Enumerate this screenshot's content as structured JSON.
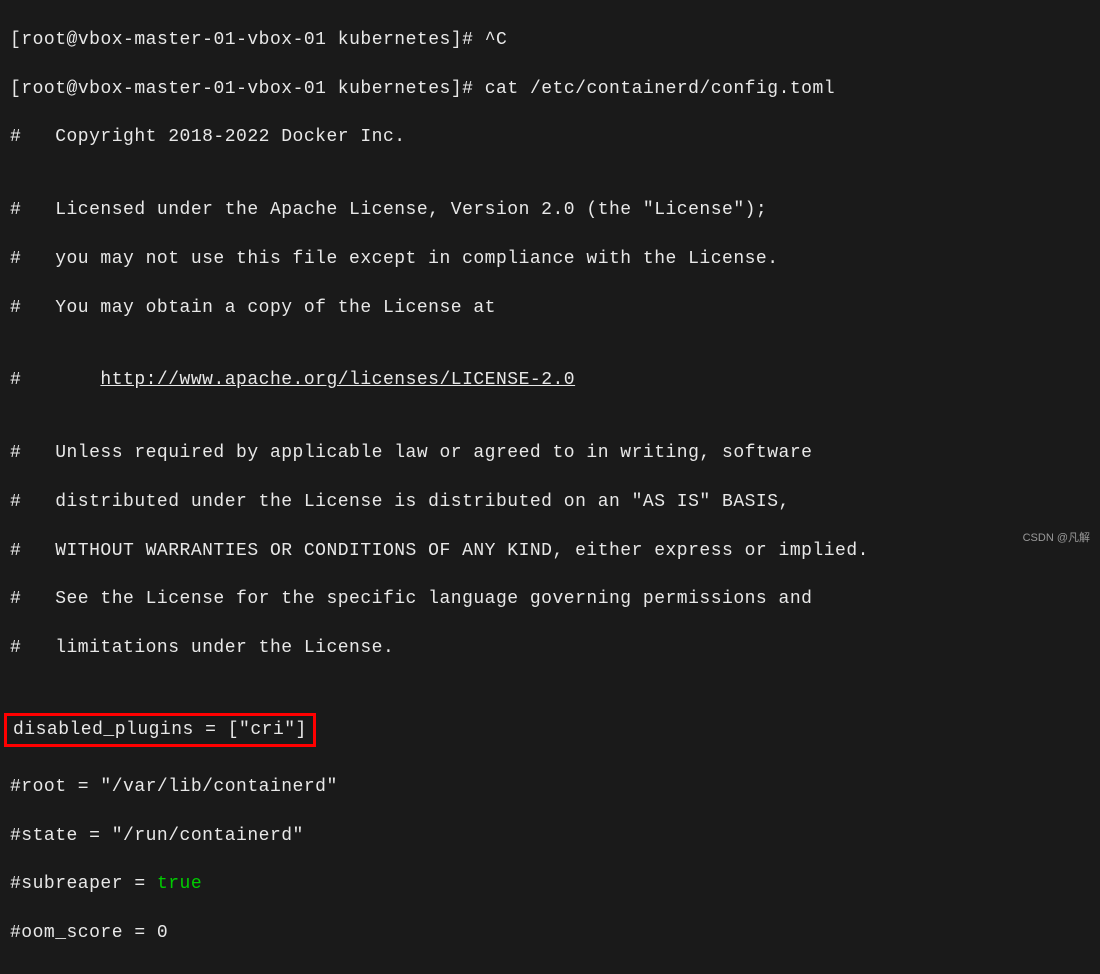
{
  "prompt1": {
    "user": "root",
    "host": "vbox-master-01-vbox-01",
    "cwd": "kubernetes",
    "command": "^C"
  },
  "prompt2": {
    "user": "root",
    "host": "vbox-master-01-vbox-01",
    "cwd": "kubernetes",
    "command": "cat /etc/containerd/config.toml"
  },
  "file": {
    "copyright": "#   Copyright 2018-2022 Docker Inc.",
    "blank1": "",
    "license1": "#   Licensed under the Apache License, Version 2.0 (the \"License\");",
    "license2": "#   you may not use this file except in compliance with the License.",
    "license3": "#   You may obtain a copy of the License at",
    "blank2": "",
    "url_prefix": "#       ",
    "url": "http://www.apache.org/licenses/LICENSE-2.0",
    "blank3": "",
    "warranty1": "#   Unless required by applicable law or agreed to in writing, software",
    "warranty2": "#   distributed under the License is distributed on an \"AS IS\" BASIS,",
    "warranty3": "#   WITHOUT WARRANTIES OR CONDITIONS OF ANY KIND, either express or implied.",
    "warranty4": "#   See the License for the specific language governing permissions and",
    "warranty5": "#   limitations under the License.",
    "blank4": "",
    "disabled_plugins": "disabled_plugins = [\"cri\"]",
    "blank5": "",
    "root": "#root = \"/var/lib/containerd\"",
    "state": "#state = \"/run/containerd\"",
    "subreaper_prefix": "#subreaper = ",
    "subreaper_value": "true",
    "oom_score": "#oom_score = 0"
  },
  "watermark": "CSDN @凡解"
}
